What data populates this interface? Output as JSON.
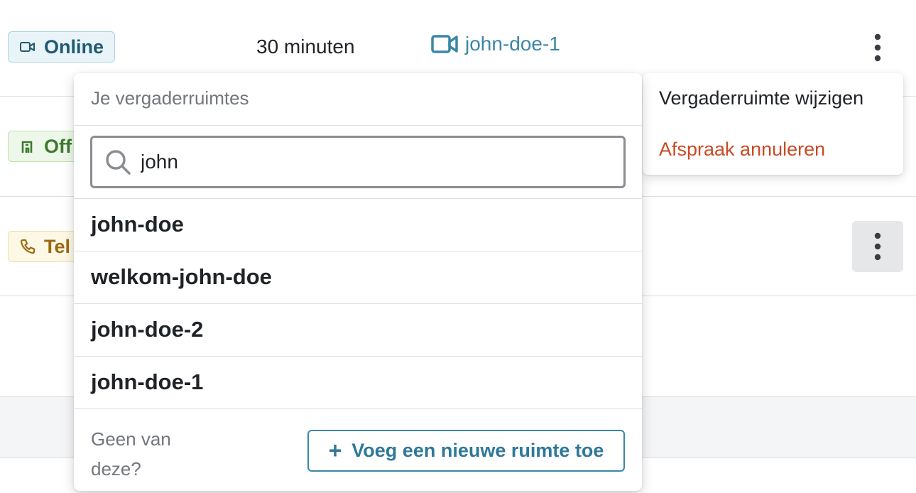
{
  "rows": [
    {
      "location_badge": {
        "label": "Online",
        "icon": "video-icon"
      },
      "duration": "30 minuten",
      "room_link": {
        "label": "john-doe-1",
        "icon": "video-camera-icon"
      }
    },
    {
      "location_badge": {
        "label": "Off",
        "icon": "building-icon"
      }
    },
    {
      "location_badge": {
        "label": "Tel",
        "icon": "phone-icon"
      }
    }
  ],
  "context_menu": {
    "items": [
      "Vergaderruimte wijzigen",
      "Afspraak annuleren"
    ]
  },
  "room_picker": {
    "title": "Je vergaderruimtes",
    "search": {
      "value": "john",
      "placeholder": ""
    },
    "options": [
      "john-doe",
      "welkom-john-doe",
      "john-doe-2",
      "john-doe-1"
    ],
    "footer_text": "Geen van deze?",
    "add_button_label": "Voeg een nieuwe ruimte toe"
  },
  "colors": {
    "accent": "#3a87a6",
    "danger": "#c94a24",
    "online_badge_bg": "#e9f4f8",
    "office_badge_bg": "#eef8ea",
    "phone_badge_bg": "#fdf8e6"
  }
}
